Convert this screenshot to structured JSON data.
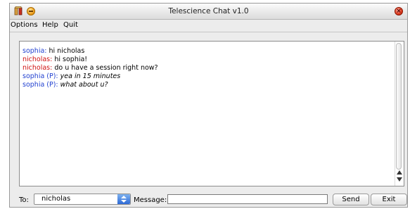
{
  "window": {
    "title": "Telescience Chat v1.0"
  },
  "menu": [
    "Options",
    "Help",
    "Quit"
  ],
  "chat": [
    {
      "sender": "sophia:",
      "text": " hi nicholas",
      "sender_color": "#1f3fd0",
      "italic": false
    },
    {
      "sender": "nicholas:",
      "text": " hi sophia!",
      "sender_color": "#d01010",
      "italic": false
    },
    {
      "sender": "nicholas:",
      "text": " do u have a session right now?",
      "sender_color": "#d01010",
      "italic": false
    },
    {
      "sender": "sophia (P):",
      "text": " yea in 15 minutes",
      "sender_color": "#1f3fd0",
      "italic": true
    },
    {
      "sender": "sophia (P):",
      "text": " what about u?",
      "sender_color": "#1f3fd0",
      "italic": true
    }
  ],
  "footer": {
    "to_label": "To:",
    "to_value": "nicholas",
    "message_label": "Message:",
    "message_value": "",
    "send_label": "Send",
    "exit_label": "Exit"
  },
  "icons": {
    "app": "app-icon",
    "minimize": "minimize-icon",
    "close": "close-icon"
  }
}
